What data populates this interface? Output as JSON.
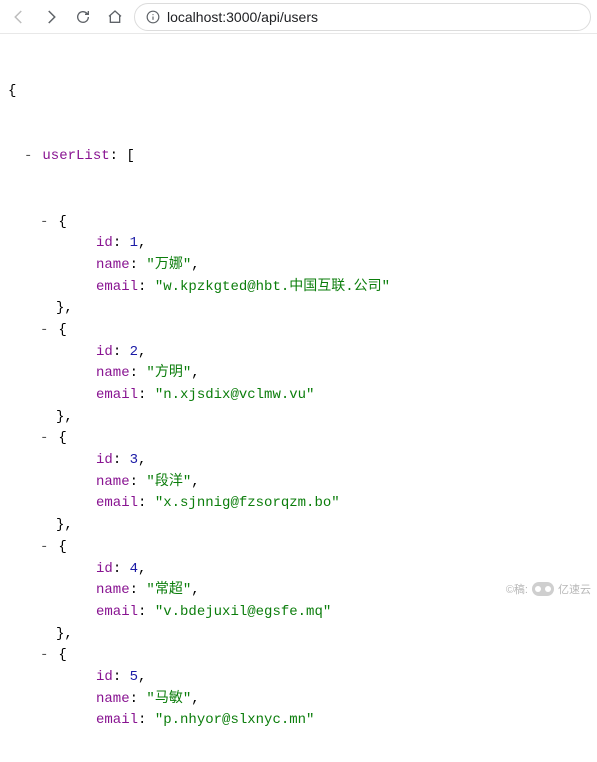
{
  "toolbar": {
    "url": "localhost:3000/api/users"
  },
  "json": {
    "root_key": "userList",
    "items": [
      {
        "id": 1,
        "name": "万娜",
        "email": "w.kpzkgted@hbt.中国互联.公司"
      },
      {
        "id": 2,
        "name": "方明",
        "email": "n.xjsdix@vclmw.vu"
      },
      {
        "id": 3,
        "name": "段洋",
        "email": "x.sjnnig@fzsorqzm.bo"
      },
      {
        "id": 4,
        "name": "常超",
        "email": "v.bdejuxil@egsfe.mq"
      },
      {
        "id": 5,
        "name": "马敏",
        "email": "p.nhyor@slxnyc.mn"
      }
    ],
    "keys": {
      "id": "id",
      "name": "name",
      "email": "email"
    }
  },
  "watermark": {
    "prefix": "©稿:",
    "brand": "亿速云"
  }
}
